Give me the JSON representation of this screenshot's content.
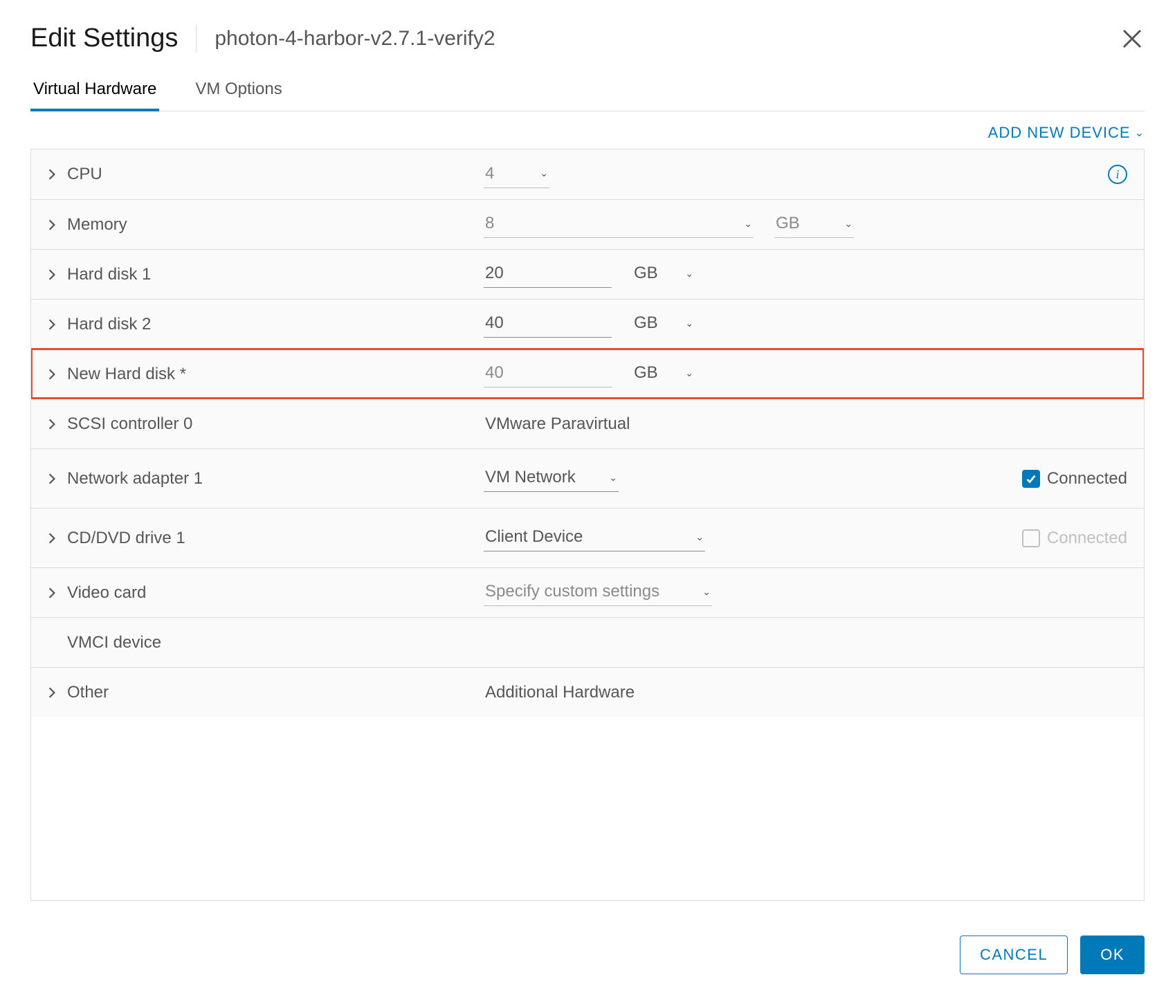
{
  "header": {
    "title": "Edit Settings",
    "subtitle": "photon-4-harbor-v2.7.1-verify2"
  },
  "tabs": {
    "hardware": "Virtual Hardware",
    "options": "VM Options"
  },
  "toolbar": {
    "add_device": "ADD NEW DEVICE"
  },
  "rows": {
    "cpu": {
      "label": "CPU",
      "value": "4"
    },
    "memory": {
      "label": "Memory",
      "value": "8",
      "unit": "GB"
    },
    "hd1": {
      "label": "Hard disk 1",
      "value": "20",
      "unit": "GB"
    },
    "hd2": {
      "label": "Hard disk 2",
      "value": "40",
      "unit": "GB"
    },
    "newhd": {
      "label": "New Hard disk *",
      "value": "40",
      "unit": "GB"
    },
    "scsi": {
      "label": "SCSI controller 0",
      "value": "VMware Paravirtual"
    },
    "net": {
      "label": "Network adapter 1",
      "value": "VM Network",
      "connected": "Connected"
    },
    "cd": {
      "label": "CD/DVD drive 1",
      "value": "Client Device",
      "connected": "Connected"
    },
    "video": {
      "label": "Video card",
      "value": "Specify custom settings"
    },
    "vmci": {
      "label": "VMCI device"
    },
    "other": {
      "label": "Other",
      "value": "Additional Hardware"
    }
  },
  "footer": {
    "cancel": "CANCEL",
    "ok": "OK"
  }
}
